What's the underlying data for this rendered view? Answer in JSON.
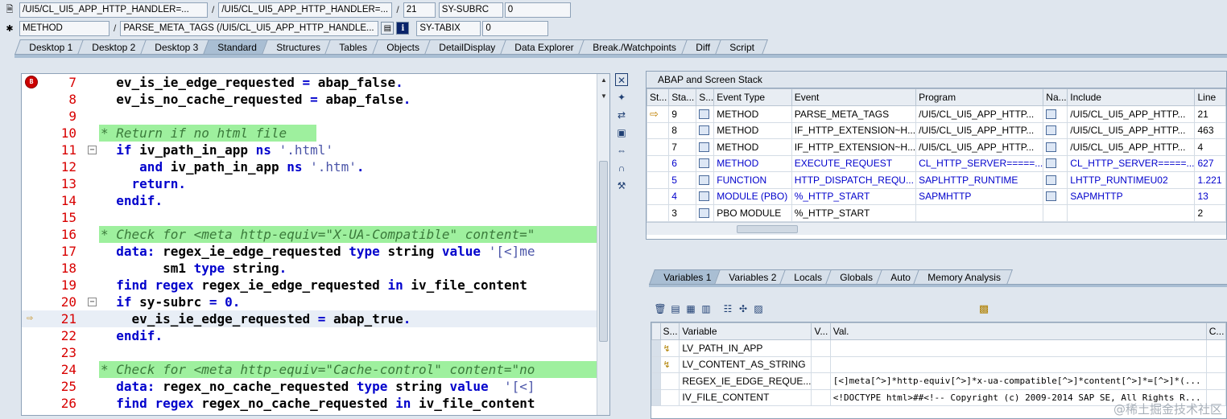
{
  "header": {
    "row1": {
      "program": "/UI5/CL_UI5_APP_HTTP_HANDLER=...",
      "include": "/UI5/CL_UI5_APP_HTTP_HANDLER=...",
      "line": "21",
      "sys_field_name": "SY-SUBRC",
      "sys_field_value": "0"
    },
    "row2": {
      "event_type": "METHOD",
      "event": "PARSE_META_TAGS (/UI5/CL_UI5_APP_HTTP_HANDLE...",
      "sys_field_name": "SY-TABIX",
      "sys_field_value": "0"
    }
  },
  "tabs": [
    {
      "label": "Desktop 1"
    },
    {
      "label": "Desktop 2"
    },
    {
      "label": "Desktop 3"
    },
    {
      "label": "Standard"
    },
    {
      "label": "Structures"
    },
    {
      "label": "Tables"
    },
    {
      "label": "Objects"
    },
    {
      "label": "DetailDisplay"
    },
    {
      "label": "Data Explorer"
    },
    {
      "label": "Break./Watchpoints"
    },
    {
      "label": "Diff"
    },
    {
      "label": "Script"
    }
  ],
  "code": {
    "lines": [
      {
        "num": "7",
        "text": "  ev_is_ie_edge_requested = abap_false."
      },
      {
        "num": "8",
        "text": "  ev_is_no_cache_requested = abap_false."
      },
      {
        "num": "9",
        "text": ""
      },
      {
        "num": "10",
        "text": "* Return if no html file"
      },
      {
        "num": "11",
        "text": "  if iv_path_in_app ns '.html'"
      },
      {
        "num": "12",
        "text": "     and iv_path_in_app ns '.htm'."
      },
      {
        "num": "13",
        "text": "    return."
      },
      {
        "num": "14",
        "text": "  endif."
      },
      {
        "num": "15",
        "text": ""
      },
      {
        "num": "16",
        "text": "* Check for <meta http-equiv=\"X-UA-Compatible\" content=\""
      },
      {
        "num": "17",
        "text": "  data: regex_ie_edge_requested type string value '[<]me"
      },
      {
        "num": "18",
        "text": "        sm1 type string."
      },
      {
        "num": "19",
        "text": "  find regex regex_ie_edge_requested in iv_file_content"
      },
      {
        "num": "20",
        "text": "  if sy-subrc = 0."
      },
      {
        "num": "21",
        "text": "    ev_is_ie_edge_requested = abap_true."
      },
      {
        "num": "22",
        "text": "  endif."
      },
      {
        "num": "23",
        "text": ""
      },
      {
        "num": "24",
        "text": "* Check for <meta http-equiv=\"Cache-control\" content=\"no"
      },
      {
        "num": "25",
        "text": "  data: regex_no_cache_requested type string value  '[<]"
      },
      {
        "num": "26",
        "text": "  find regex regex_no_cache_requested in iv_file_content"
      }
    ]
  },
  "stack": {
    "title": "ABAP and Screen Stack",
    "columns": [
      "St...",
      "Sta...",
      "S...",
      "Event Type",
      "Event",
      "Program",
      "Na...",
      "Include",
      "Line"
    ],
    "rows": [
      {
        "stack_no": "9",
        "event_type": "METHOD",
        "event": "PARSE_META_TAGS",
        "program": "/UI5/CL_UI5_APP_HTTP...",
        "include": "/UI5/CL_UI5_APP_HTTP...",
        "line": "21",
        "blue": false,
        "current": true
      },
      {
        "stack_no": "8",
        "event_type": "METHOD",
        "event": "IF_HTTP_EXTENSION~H...",
        "program": "/UI5/CL_UI5_APP_HTTP...",
        "include": "/UI5/CL_UI5_APP_HTTP...",
        "line": "463",
        "blue": false,
        "current": false
      },
      {
        "stack_no": "7",
        "event_type": "METHOD",
        "event": "IF_HTTP_EXTENSION~H...",
        "program": "/UI5/CL_UI5_APP_HTTP...",
        "include": "/UI5/CL_UI5_APP_HTTP...",
        "line": "4",
        "blue": false,
        "current": false
      },
      {
        "stack_no": "6",
        "event_type": "METHOD",
        "event": "EXECUTE_REQUEST",
        "program": "CL_HTTP_SERVER=====...",
        "include": "CL_HTTP_SERVER=====...",
        "line": "627",
        "blue": true,
        "current": false
      },
      {
        "stack_no": "5",
        "event_type": "FUNCTION",
        "event": "HTTP_DISPATCH_REQU...",
        "program": "SAPLHTTP_RUNTIME",
        "include": "LHTTP_RUNTIMEU02",
        "line": "1.221",
        "blue": true,
        "current": false
      },
      {
        "stack_no": "4",
        "event_type": "MODULE (PBO)",
        "event": "%_HTTP_START",
        "program": "SAPMHTTP",
        "include": "SAPMHTTP",
        "line": "13",
        "blue": true,
        "current": false
      },
      {
        "stack_no": "3",
        "event_type": "PBO MODULE",
        "event": "%_HTTP_START",
        "program": "",
        "include": "",
        "line": "2",
        "blue": false,
        "current": false
      }
    ]
  },
  "var_tabs": [
    {
      "label": "Variables 1"
    },
    {
      "label": "Variables 2"
    },
    {
      "label": "Locals"
    },
    {
      "label": "Globals"
    },
    {
      "label": "Auto"
    },
    {
      "label": "Memory Analysis"
    }
  ],
  "variables": {
    "columns": [
      "S...",
      "Variable",
      "V...",
      "Val.",
      "C..."
    ],
    "rows": [
      {
        "name": "LV_PATH_IN_APP",
        "value": ""
      },
      {
        "name": "LV_CONTENT_AS_STRING",
        "value": ""
      },
      {
        "name": "REGEX_IE_EDGE_REQUE...",
        "value": "[<]meta[^>]*http-equiv[^>]*x-ua-compatible[^>]*content[^>]*=[^>]*(..."
      },
      {
        "name": "IV_FILE_CONTENT",
        "value": "<!DOCTYPE html>##<!-- Copyright (c) 2009-2014 SAP SE, All Rights R..."
      }
    ]
  },
  "watermark": "@稀土掘金技术社区",
  "colors": {
    "accent": "#a9bed3",
    "comment_bg": "#9ef09e",
    "keyword": "#0000cc",
    "line_number": "#d80000"
  }
}
